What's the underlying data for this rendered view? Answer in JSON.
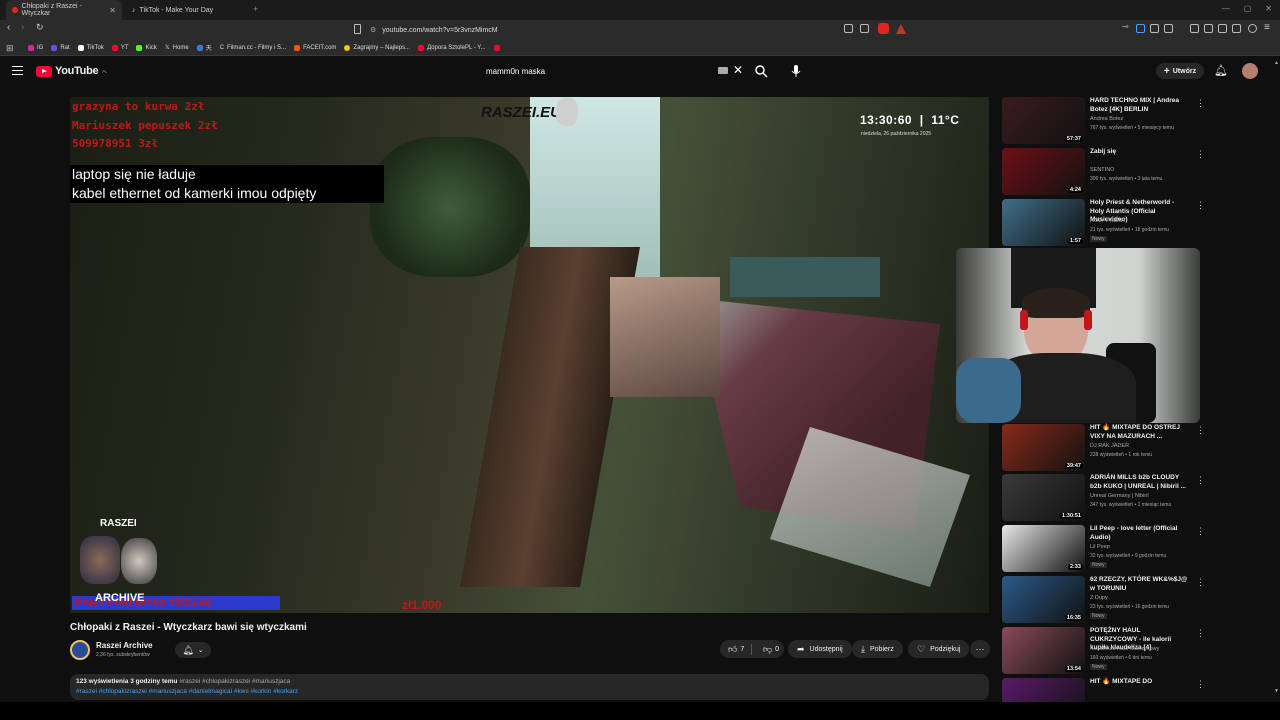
{
  "browser": {
    "tabs": [
      {
        "label": "Chłopaki z Raszei - Wtyczkar",
        "active": true
      },
      {
        "label": "TikTok - Make Your Day",
        "active": false
      }
    ],
    "url": "youtube.com/watch?v=5r3vnzMimcM",
    "bookmarks": [
      "IG",
      "Rat",
      "TikTok",
      "YT",
      "Kick",
      "Home",
      "天",
      "Filman.cc - Filmy i S...",
      "FACEIT.com",
      "Zagrajmy – Najleps...",
      "Дорога SztolePL - Y..."
    ]
  },
  "youtube": {
    "logo_text": "YouTube",
    "region": "PL",
    "search_value": "mamm0n maska",
    "create_label": "Utwórz"
  },
  "video": {
    "overlay_lines": [
      "grazyna to kurwa  2zł",
      "Mariuszek pepuszek  2zł",
      "509978951  3zł"
    ],
    "caption_line1": "laptop się nie ładuje",
    "caption_line2": "kabel ethernet od kamerki imou odpięty",
    "watermark": "RASZEI.EU",
    "clock_time": "13:30:60",
    "clock_temp": "11°C",
    "clock_date": "niedziela, 26 października 2025",
    "archive_top": "RASZEI",
    "archive_bottom": "ARCHIVE",
    "donation_left": "Poniż Pred Glovo  zł525.60",
    "donation_right": "zł1.000"
  },
  "meta": {
    "title": "Chłopaki z Raszei - Wtyczkarz bawi się wtyczkami",
    "channel": "Raszei Archive",
    "subscribers": "2,36 tys. subskrybentów",
    "likes": "7",
    "dislikes": "0",
    "share_label": "Udostępnij",
    "download_label": "Pobierz",
    "thanks_label": "Podziękuj",
    "desc_stats": "123 wyświetlenia  3 godziny temu",
    "desc_tags1": "#raszei #chlopakizraszei #mariuszjaca",
    "desc_tags2": "#raszei #chlopakizraszei #mariuszjaca #danielmagical #kws #korkin #korkarz"
  },
  "recommendations": [
    {
      "title": "HARD TECHNO MIX | Andrea Botez [4K] BERLIN",
      "channel": "Andrea Botez",
      "meta": "767 tys. wyświetleń • 5 miesięcy temu",
      "duration": "57:37",
      "badge": "",
      "color": "#3b1b1f"
    },
    {
      "title": "Zabij się",
      "channel": "SENTINO",
      "meta": "306 tys. wyświetleń • 3 lata temu",
      "duration": "4:24",
      "badge": "",
      "color": "#6e1016"
    },
    {
      "title": "Holy Priest & Netherworld - Holy Atlantis (Official Musicvideo)",
      "channel": "HOLY PRIEST",
      "meta": "21 tys. wyświetleń • 18 godzin temu",
      "duration": "1:57",
      "badge": "Nowy",
      "color": "#3f6f8a"
    },
    {
      "title": "HIT 🔥 MIXTAPE DO OSTREJ VIXY NA MAZURACH ...",
      "channel": "DJ RAK JADER",
      "meta": "228 wyświetleń • 1 rok temu",
      "duration": "39:47",
      "badge": "",
      "color": "#8a2a1a"
    },
    {
      "title": "ADRIÁN MILLS b2b CLOUDY b2b KUKO | UNREAL | Nibiril ...",
      "channel": "Unreal Germany | Nibiril",
      "meta": "347 tys. wyświetleń • 1 miesiąc temu",
      "duration": "1:30:51",
      "badge": "",
      "color": "#3a3a3a"
    },
    {
      "title": "Lil Peep - love letter (Official Audio)",
      "channel": "Lil Peep",
      "meta": "32 tys. wyświetleń • 9 godzin temu",
      "duration": "2:33",
      "badge": "Nowy",
      "color": "#e8e8e8"
    },
    {
      "title": "62 RZECZY, KTÓRE WK&%$J@ w TORUNIU",
      "channel": "Z Dupy",
      "meta": "23 tys. wyświetleń • 16 godzin temu",
      "duration": "16:35",
      "badge": "Nowy",
      "color": "#2a5a8a"
    },
    {
      "title": "POTĘŻNY HAUL CUKRZYCOWY - ile kalorii kupiła klaudeliza [4]",
      "channel": "Klaudeliza Haul Cukrzycowy",
      "meta": "160 wyświetleń • 6 dni temu",
      "duration": "13:54",
      "badge": "Nowy",
      "color": "#8a4a5a"
    },
    {
      "title": "HIT 🔥 MIXTAPE DO",
      "channel": "",
      "meta": "",
      "duration": "",
      "badge": "",
      "color": "#5a1a6a"
    }
  ]
}
